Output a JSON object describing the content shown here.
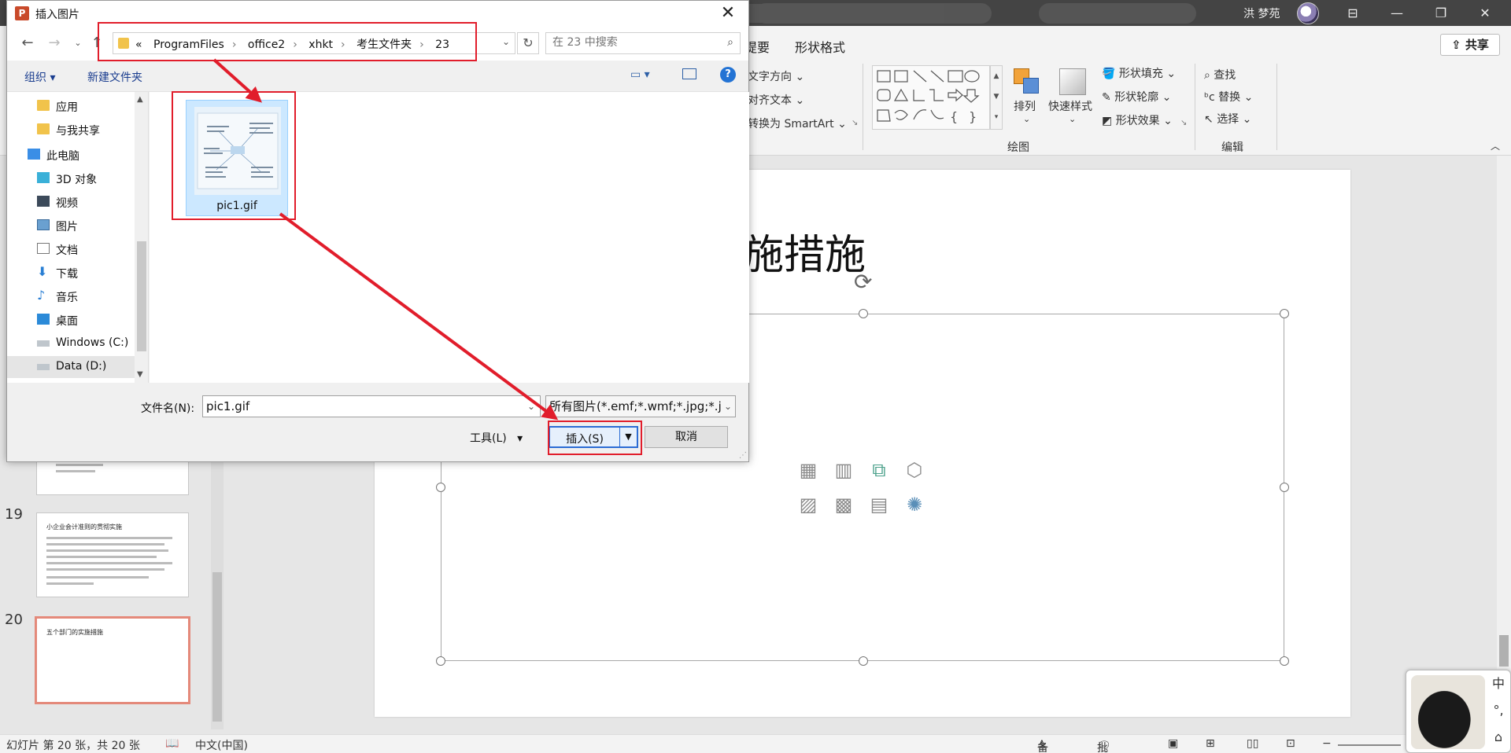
{
  "powerpoint": {
    "user_name": "洪 梦苑",
    "ribbon_tabs": [
      "提要",
      "形状格式"
    ],
    "share_label": "共享",
    "paragraph_cmds": [
      "文字方向",
      "对齐文本",
      "转换为 SmartArt"
    ],
    "arrange_label": "排列",
    "quick_styles_label": "快速样式",
    "shape_cmds": [
      "形状填充",
      "形状轮廓",
      "形状效果"
    ],
    "drawing_group_label": "绘图",
    "edit_cmds": [
      "查找",
      "替换",
      "选择"
    ],
    "edit_group_label": "编辑",
    "slide_title": "施措施",
    "thumbnails": [
      {
        "number": "19",
        "title": "小企业会计准则的贯彻实施"
      },
      {
        "number": "20",
        "title": "五个部门的实施措施"
      }
    ],
    "status": {
      "slide_info": "幻灯片 第 20 张，共 20 张",
      "language": "中文(中国)",
      "notes": "备注",
      "comments": "批注"
    },
    "ime_keys": [
      "中",
      "°,",
      "⌂"
    ]
  },
  "dialog": {
    "title": "插入图片",
    "breadcrumb": [
      "«",
      "ProgramFiles",
      "office2",
      "xhkt",
      "考生文件夹",
      "23"
    ],
    "search_placeholder": "在 23 中搜索",
    "organize_label": "组织",
    "new_folder_label": "新建文件夹",
    "nav_items": [
      {
        "label": "应用",
        "icon": "folder-icon"
      },
      {
        "label": "与我共享",
        "icon": "folder-icon"
      },
      {
        "label": "此电脑",
        "icon": "computer-icon"
      },
      {
        "label": "3D 对象",
        "icon": "cube-icon"
      },
      {
        "label": "视频",
        "icon": "video-icon"
      },
      {
        "label": "图片",
        "icon": "picture-icon"
      },
      {
        "label": "文档",
        "icon": "document-icon"
      },
      {
        "label": "下载",
        "icon": "download-icon"
      },
      {
        "label": "音乐",
        "icon": "music-icon"
      },
      {
        "label": "桌面",
        "icon": "desktop-icon"
      },
      {
        "label": "Windows (C:)",
        "icon": "drive-icon"
      },
      {
        "label": "Data (D:)",
        "icon": "drive-icon"
      }
    ],
    "file": {
      "name": "pic1.gif"
    },
    "filename_label": "文件名(N):",
    "filename_value": "pic1.gif",
    "filetype_value": "所有图片(*.emf;*.wmf;*.jpg;*.j",
    "tools_label": "工具(L)",
    "insert_label": "插入(S)",
    "cancel_label": "取消"
  },
  "colors": {
    "annotation_red": "#e11d2b",
    "selection_blue": "#cce8ff",
    "accent_blue": "#2b6cd4"
  }
}
